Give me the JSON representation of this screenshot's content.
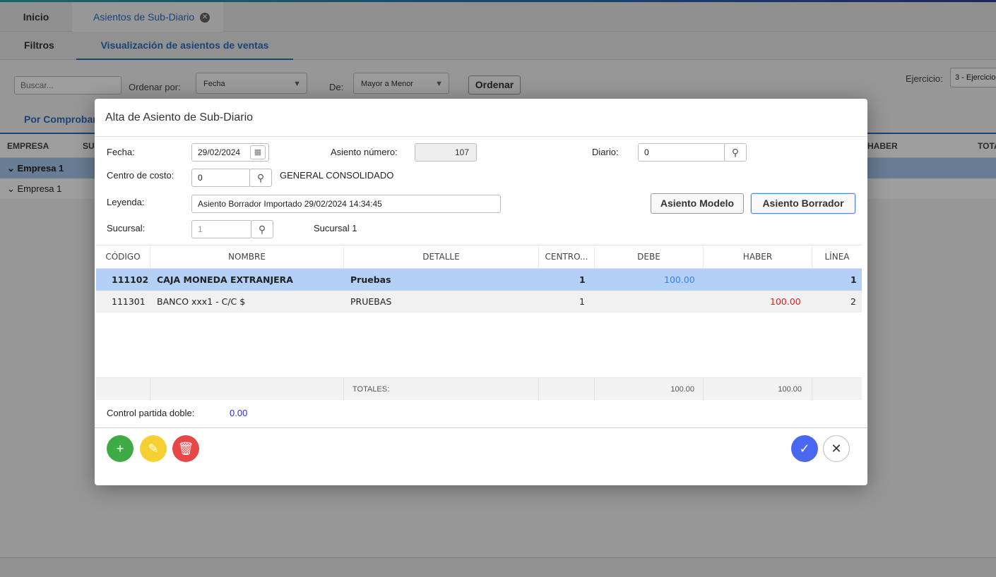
{
  "tabs": {
    "inicio": "Inicio",
    "sub_diario": "Asientos de Sub-Diario"
  },
  "subtabs": {
    "filtros": "Filtros",
    "visualizacion": "Visualización de asientos de ventas"
  },
  "filters": {
    "search_placeholder": "Buscar...",
    "ordenar_label": "Ordenar por:",
    "ordenar_value": "Fecha",
    "de_label": "De:",
    "de_value": "Mayor a Menor",
    "ordenar_button": "Ordenar",
    "ejercicio_label": "Ejercicio:",
    "ejercicio_value": "3 - Ejercicio"
  },
  "background": {
    "tab_por_comprobante": "Por Comprobante",
    "columns": {
      "empresa": "EMPRESA",
      "su": "SU",
      "haber": "HABER",
      "total": "TOTAL"
    },
    "rows": [
      "Empresa 1",
      "Empresa 1"
    ]
  },
  "modal": {
    "title": "Alta de Asiento de Sub-Diario",
    "fecha_label": "Fecha:",
    "fecha_value": "29/02/2024",
    "asiento_numero_label": "Asiento número:",
    "asiento_numero_value": "107",
    "diario_label": "Diario:",
    "diario_value": "0",
    "centro_costo_label": "Centro de costo:",
    "centro_costo_value": "0",
    "centro_costo_name": "GENERAL CONSOLIDADO",
    "leyenda_label": "Leyenda:",
    "leyenda_value": "Asiento Borrador Importado 29/02/2024 14:34:45",
    "sucursal_label": "Sucursal:",
    "sucursal_value": "1",
    "sucursal_name": "Sucursal 1",
    "btn_asiento_modelo": "Asiento Modelo",
    "btn_asiento_borrador": "Asiento Borrador",
    "grid": {
      "headers": [
        "CÓDIGO",
        "NOMBRE",
        "DETALLE",
        "CENTRO...",
        "DEBE",
        "HABER",
        "LÍNEA"
      ],
      "rows": [
        {
          "codigo": "111102",
          "nombre": "CAJA MONEDA EXTRANJERA",
          "detalle": "Pruebas",
          "centro": "1",
          "debe": "100.00",
          "haber": "",
          "linea": "1"
        },
        {
          "codigo": "111301",
          "nombre": "BANCO xxx1 - C/C $",
          "detalle": "PRUEBAS",
          "centro": "1",
          "debe": "",
          "haber": "100.00",
          "linea": "2"
        }
      ],
      "totals_label": "TOTALES:",
      "total_debe": "100.00",
      "total_haber": "100.00"
    },
    "control_label": "Control partida doble:",
    "control_value": "0.00"
  },
  "colors": {
    "accent": "#2b6cc0",
    "debe": "#3a7fe0",
    "haber": "#e01b1b",
    "add": "#3fab44",
    "edit": "#f6d033",
    "delete": "#e84747",
    "confirm": "#4a67f0"
  }
}
